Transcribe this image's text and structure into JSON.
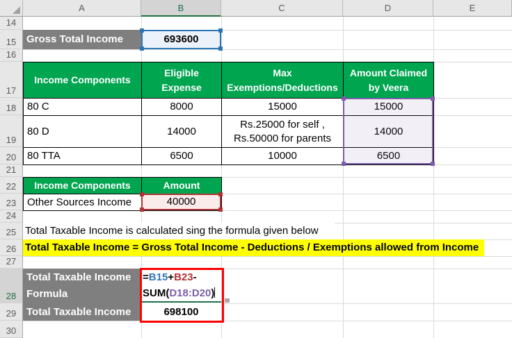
{
  "sheet": {
    "column_headers": [
      "A",
      "B",
      "C",
      "D",
      "E"
    ],
    "row_numbers": [
      "14",
      "15",
      "16",
      "17",
      "18",
      "19",
      "20",
      "21",
      "22",
      "23",
      "24",
      "25",
      "26",
      "27",
      "28",
      "29",
      "30"
    ],
    "active_column": "B",
    "active_row": "28"
  },
  "colors": {
    "header_green": "#00A550",
    "label_gray": "#7F7F7F",
    "highlight_yellow": "#FFFF00",
    "ref_blue": "#2E75B6",
    "ref_red": "#B03232",
    "ref_purple": "#7B5EA7",
    "formula_border_red": "#FF0000",
    "edit_line_green": "#1E7145"
  },
  "gross_income": {
    "label": "Gross Total Income",
    "value": "693600"
  },
  "deductions_table": {
    "headers": {
      "component": "Income Components",
      "eligible_line1": "Eligible",
      "eligible_line2": "Expense",
      "max_line1": "Max",
      "max_line2": "Exemptions/Deductions",
      "claimed_line1": "Amount Claimed",
      "claimed_line2": "by Veera"
    },
    "rows": [
      {
        "component": "80 C",
        "eligible": "8000",
        "max": "15000",
        "claimed": "15000"
      },
      {
        "component": "80 D",
        "eligible": "14000",
        "max_line1": "Rs.25000 for self ,",
        "max_line2": "Rs.50000 for parents",
        "claimed": "14000"
      },
      {
        "component": "80 TTA",
        "eligible": "6500",
        "max": "10000",
        "claimed": "6500"
      }
    ]
  },
  "other_income": {
    "header_component": "Income Components",
    "header_amount": "Amount",
    "component": "Other Sources Income",
    "amount": "40000"
  },
  "notes": {
    "description": "Total Taxable Income is calculated sing the formula given below",
    "highlight": "Total Taxable Income = Gross Total Income - Deductions / Exemptions allowed from Income"
  },
  "result": {
    "formula_label_line1": "Total Taxable Income",
    "formula_label_line2": "Formula",
    "formula": {
      "eq": "=",
      "ref1": "B15",
      "plus": "+",
      "ref2": "B23",
      "minus": "-",
      "sum_open": "SUM(",
      "range": "D18:D20",
      "close": ")"
    },
    "result_label": "Total Taxable Income",
    "result_value": "698100"
  }
}
